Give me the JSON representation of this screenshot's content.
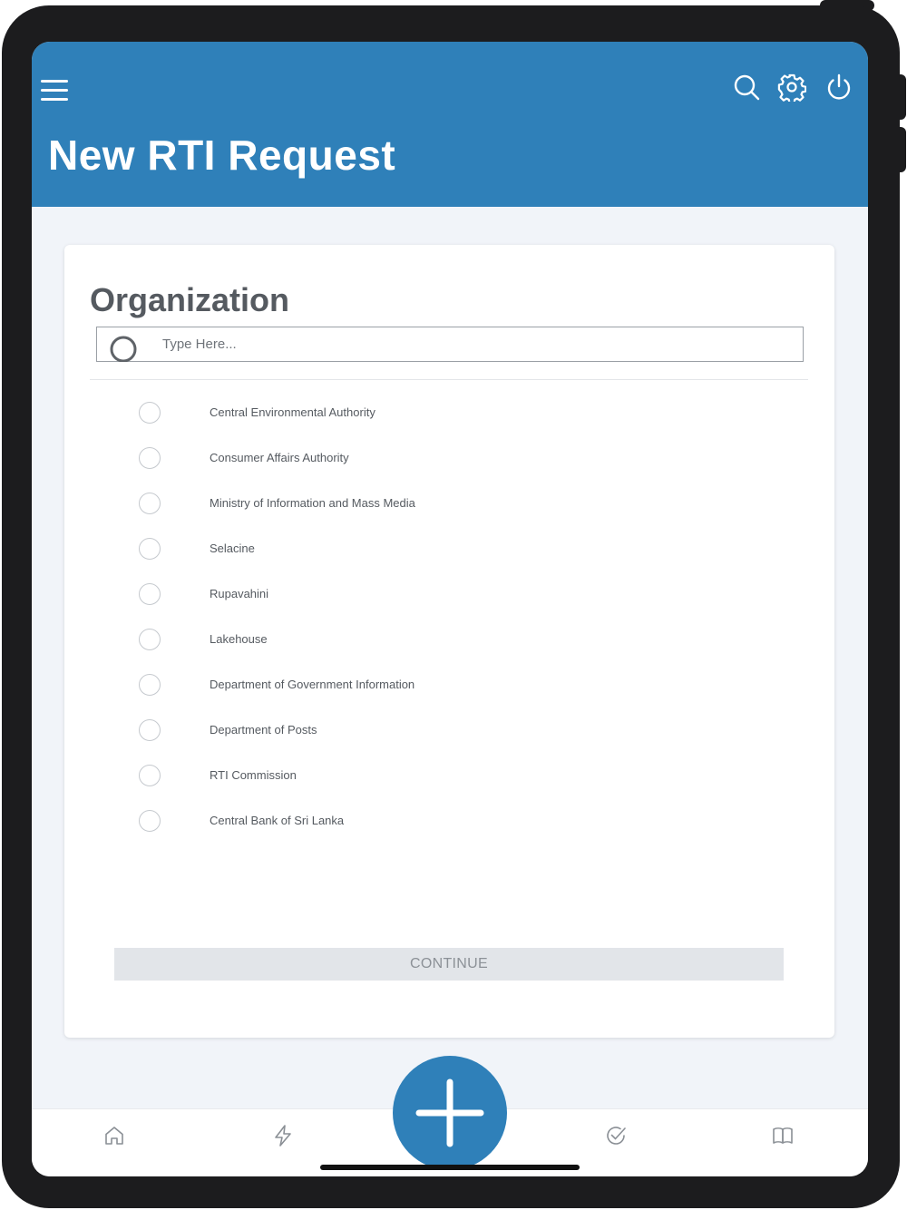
{
  "header": {
    "title": "New RTI Request",
    "accent_color": "#2f80b9",
    "icons": [
      "menu-icon",
      "search-icon",
      "gear-icon",
      "power-icon"
    ]
  },
  "organization": {
    "heading": "Organization",
    "search": {
      "placeholder": "Type Here...",
      "value": ""
    },
    "items": [
      {
        "label": "Central Environmental Authority",
        "selected": false
      },
      {
        "label": "Consumer Affairs Authority",
        "selected": false
      },
      {
        "label": "Ministry of Information and Mass Media",
        "selected": false
      },
      {
        "label": "Selacine",
        "selected": false
      },
      {
        "label": "Rupavahini",
        "selected": false
      },
      {
        "label": "Lakehouse",
        "selected": false
      },
      {
        "label": "Department of Government Information",
        "selected": false
      },
      {
        "label": "Department of Posts",
        "selected": false
      },
      {
        "label": "RTI Commission",
        "selected": false
      },
      {
        "label": "Central Bank of Sri Lanka",
        "selected": false
      }
    ],
    "continue_label": "CONTINUE"
  },
  "tabbar": {
    "icons": [
      "home-icon",
      "bolt-icon",
      "plus-icon",
      "check-circle-icon",
      "book-icon"
    ]
  }
}
